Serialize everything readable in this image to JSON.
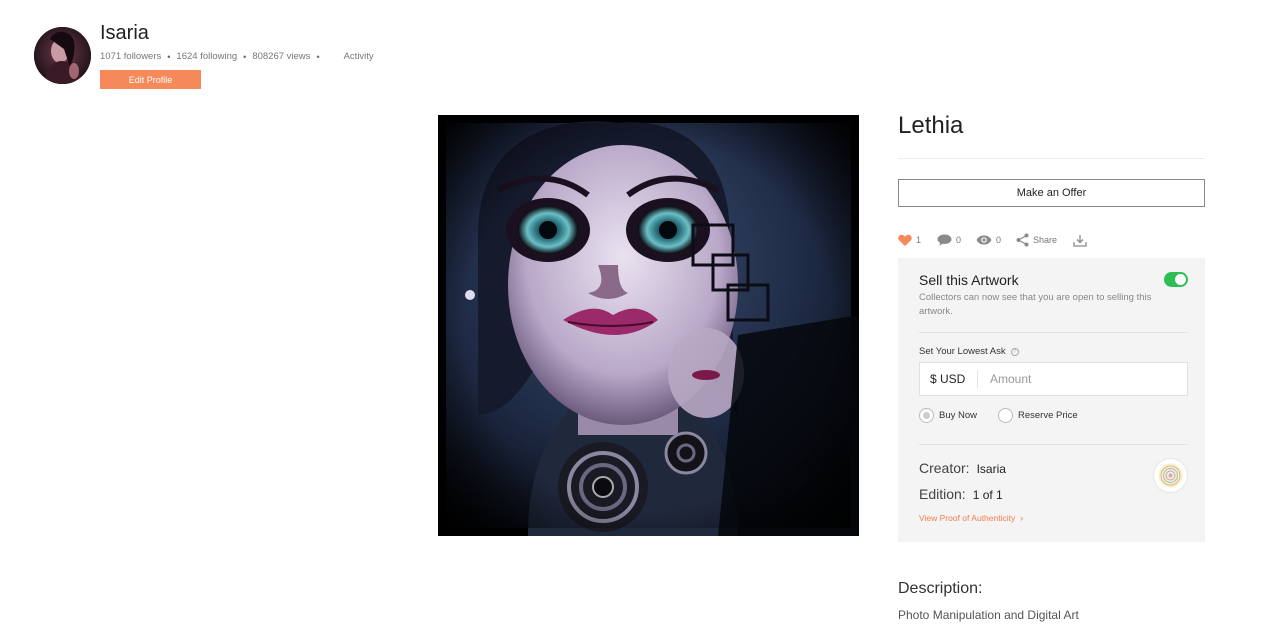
{
  "profile": {
    "name": "Isaria",
    "followers": "1071 followers",
    "following": "1624 following",
    "views": "808267 views",
    "separator": "•",
    "activity_label": "Activity",
    "edit_label": "Edit Profile"
  },
  "artwork": {
    "title": "Lethia",
    "image_icon": "artwork-image"
  },
  "actions": {
    "offer_label": "Make an Offer",
    "likes": "1",
    "comments": "0",
    "views": "0",
    "share_label": "Share",
    "icons": [
      "heart-icon",
      "comment-icon",
      "eye-icon",
      "share-icon",
      "download-icon"
    ]
  },
  "sell": {
    "title": "Sell this Artwork",
    "toggle_on": true,
    "description": "Collectors can now see that you are open to selling this artwork.",
    "ask_label": "Set Your Lowest Ask",
    "currency": "$ USD",
    "amount_placeholder": "Amount",
    "options": [
      "Buy Now",
      "Reserve Price"
    ],
    "selected_option": "Buy Now",
    "creator_label": "Creator:",
    "creator_value": "Isaria",
    "edition_label": "Edition:",
    "edition_value": "1 of 1",
    "proof_label": "View Proof of Authenticity",
    "proof_chevron": "›"
  },
  "description": {
    "heading": "Description:",
    "text": "Photo Manipulation and Digital Art"
  },
  "colors": {
    "accent_orange": "#f5895a",
    "link_orange": "#f07d4c",
    "toggle_green": "#2dbf54",
    "heart": "#f5895a"
  }
}
